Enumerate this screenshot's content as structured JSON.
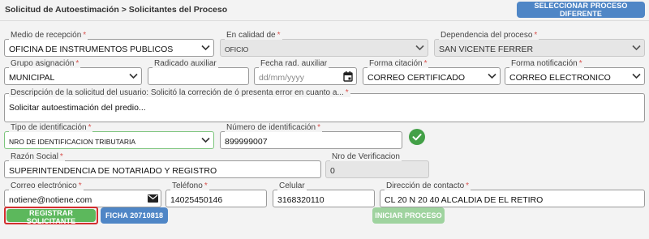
{
  "header": {
    "breadcrumb": "Solicitud de Autoestimación > Solicitantes del Proceso",
    "select_process_label": "SELECCIONAR PROCESO DIFERENTE"
  },
  "fields": {
    "medio_recepcion": {
      "label": "Medio de recepción",
      "value": "OFICINA DE INSTRUMENTOS PUBLICOS"
    },
    "en_calidad_de": {
      "label": "En calidad de",
      "value": "OFICIO"
    },
    "dependencia": {
      "label": "Dependencia del proceso",
      "value": "SAN VICENTE FERRER"
    },
    "grupo_asignacion": {
      "label": "Grupo asignación",
      "value": "MUNICIPAL"
    },
    "radicado_auxiliar": {
      "label": "Radicado auxiliar",
      "value": ""
    },
    "fecha_rad_auxiliar": {
      "label": "Fecha rad. auxiliar",
      "placeholder": "dd/mm/yyyy"
    },
    "forma_citacion": {
      "label": "Forma citación",
      "value": "CORREO CERTIFICADO"
    },
    "forma_notificacion": {
      "label": "Forma notificación",
      "value": "CORREO ELECTRONICO"
    },
    "descripcion": {
      "label": "Descripción de la solicitud del usuario: Solicitó la correción de ó presenta error en cuanto a...",
      "value": "Solicitar autoestimación del predio..."
    },
    "tipo_identificacion": {
      "label": "Tipo de identificación",
      "value": "NRO DE IDENTIFICACION TRIBUTARIA"
    },
    "numero_identificacion": {
      "label": "Número de identificación",
      "value": "899999007"
    },
    "razon_social": {
      "label": "Razón Social",
      "value": "SUPERINTENDENCIA DE NOTARIADO Y REGISTRO"
    },
    "nro_verificacion": {
      "label": "Nro de Verificacion",
      "value": "0"
    },
    "correo": {
      "label": "Correo electrónico",
      "value": "notiene@notiene.com"
    },
    "telefono": {
      "label": "Teléfono",
      "value": "14025450146"
    },
    "celular": {
      "label": "Celular",
      "value": "3168320110"
    },
    "direccion": {
      "label": "Dirección de contacto",
      "value": "CL 20 N 20 40 ALCALDIA DE EL RETIRO"
    }
  },
  "required_mark": "*",
  "actions": {
    "registrar_label": "REGISTRAR SOLICITANTE",
    "ficha_label": "FICHA 20710818",
    "iniciar_label": "INICIAR PROCESO"
  },
  "colors": {
    "primary_blue": "#4f86c6",
    "success_green": "#5cb85c",
    "disabled_green": "#9fd39f",
    "highlight_red": "#d32f2f",
    "required_red": "#d9534f",
    "check_green": "#43a047"
  }
}
